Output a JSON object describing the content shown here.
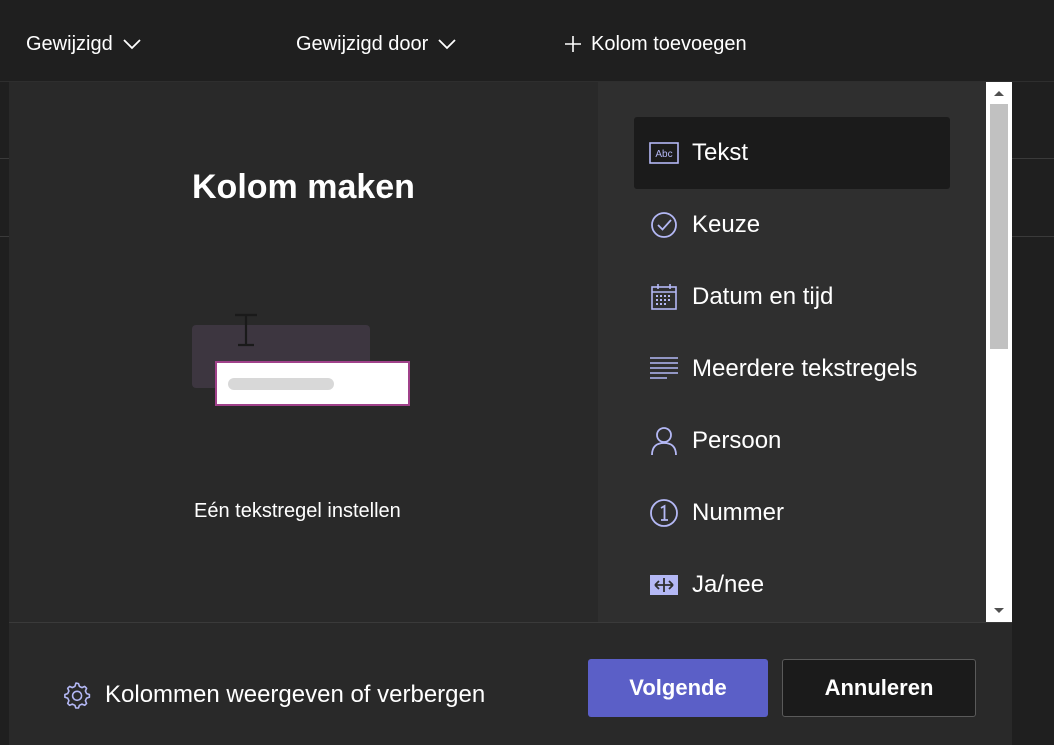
{
  "header": {
    "col_modified": "Gewijzigd",
    "col_modified_by": "Gewijzigd door",
    "add_column": "Kolom toevoegen"
  },
  "panel": {
    "title": "Kolom maken",
    "description": "Eén tekstregel instellen"
  },
  "column_types": [
    {
      "label": "Tekst",
      "icon": "text-abc-icon",
      "selected": true
    },
    {
      "label": "Keuze",
      "icon": "choice-check-icon",
      "selected": false
    },
    {
      "label": "Datum en tijd",
      "icon": "calendar-icon",
      "selected": false
    },
    {
      "label": "Meerdere tekstregels",
      "icon": "multiline-text-icon",
      "selected": false
    },
    {
      "label": "Persoon",
      "icon": "person-icon",
      "selected": false
    },
    {
      "label": "Nummer",
      "icon": "number-icon",
      "selected": false
    },
    {
      "label": "Ja/nee",
      "icon": "yes-no-icon",
      "selected": false
    }
  ],
  "footer": {
    "toggle_columns": "Kolommen weergeven of verbergen",
    "next_button": "Volgende",
    "cancel_button": "Annuleren"
  },
  "colors": {
    "accent": "#5b5fc7",
    "icon_tint": "#b4b8f5",
    "background": "#292929"
  }
}
